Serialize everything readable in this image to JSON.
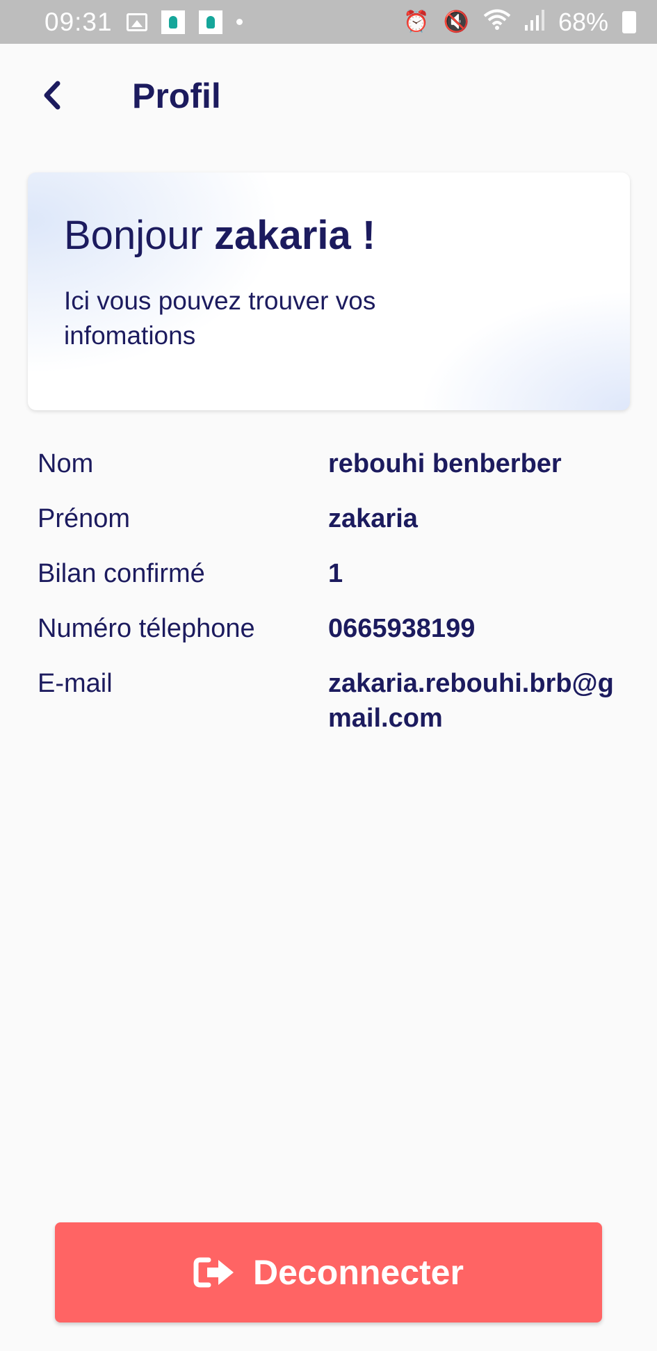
{
  "status_bar": {
    "time": "09:31",
    "battery": "68%",
    "icons": [
      "image-icon",
      "app-notification-icon",
      "app-notification-icon",
      "dot-icon",
      "alarm-icon",
      "mute-icon",
      "wifi-icon",
      "signal-icon",
      "battery-icon"
    ]
  },
  "header": {
    "title": "Profil",
    "back_icon": "chevron-left-icon"
  },
  "greeting": {
    "prefix": "Bonjour",
    "name": "zakaria",
    "suffix": "!",
    "subtitle": "Ici vous pouvez trouver vos infomations"
  },
  "info": {
    "rows": [
      {
        "label": "Nom",
        "value": "rebouhi benberber"
      },
      {
        "label": "Prénom",
        "value": "zakaria"
      },
      {
        "label": "Bilan confirmé",
        "value": "1"
      },
      {
        "label": "Numéro télephone",
        "value": "0665938199"
      },
      {
        "label": "E-mail",
        "value": "zakaria.rebouhi.brb@gmail.com"
      }
    ]
  },
  "logout": {
    "label": "Deconnecter",
    "icon": "sign-out-icon",
    "color": "#ff6464"
  },
  "colors": {
    "primary_text": "#1c1b5e",
    "background": "#fafafa",
    "status_bar": "#bdbdbd",
    "danger": "#ff6464"
  }
}
